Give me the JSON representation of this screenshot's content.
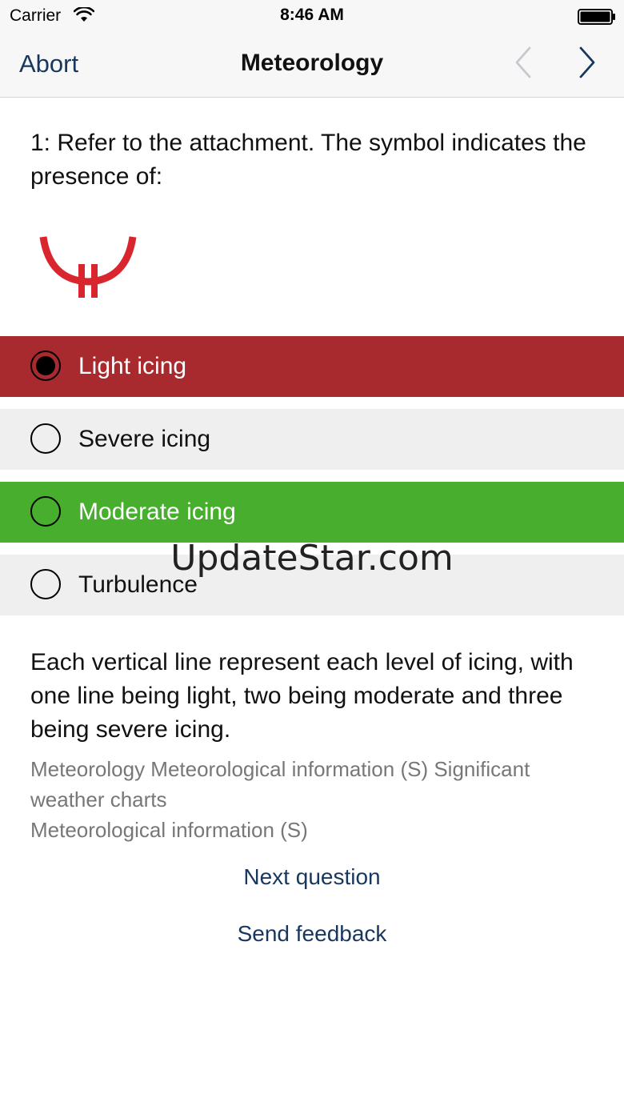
{
  "status_bar": {
    "carrier": "Carrier",
    "time": "8:46 AM",
    "wifi_icon": "wifi-icon",
    "battery_icon": "battery-icon"
  },
  "nav": {
    "abort_label": "Abort",
    "title": "Meteorology",
    "prev_icon": "chevron-left-icon",
    "next_icon": "chevron-right-icon"
  },
  "question": {
    "text": "1: Refer to the attachment. The symbol indicates the presence of:",
    "symbol_icon": "icing-symbol-icon",
    "symbol_color": "#d9262e"
  },
  "answers": [
    {
      "label": "Light icing",
      "state": "selected-wrong",
      "color": "#a82a2f"
    },
    {
      "label": "Severe icing",
      "state": "unselected",
      "color": "#efefef"
    },
    {
      "label": "Moderate icing",
      "state": "correct",
      "color": "#48ae2d"
    },
    {
      "label": "Turbulence",
      "state": "unselected",
      "color": "#efefef"
    }
  ],
  "watermark": "UpdateStar.com",
  "explanation": {
    "text": "Each vertical line represent each level of icing, with one line being light, two being moderate and three being severe icing.",
    "category_line1": "Meteorology Meteorological information (S) Significant weather charts",
    "category_line2": "Meteorological information (S)"
  },
  "links": {
    "next_question": "Next question",
    "send_feedback": "Send feedback"
  },
  "colors": {
    "accent": "#17375e",
    "wrong": "#a82a2f",
    "correct": "#48ae2d"
  }
}
